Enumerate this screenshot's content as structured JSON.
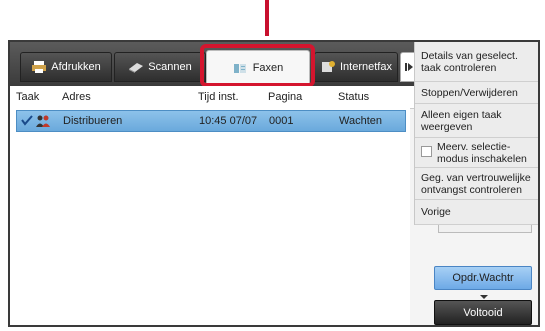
{
  "tabs": [
    {
      "label": "Afdrukken",
      "icon": "printer-icon"
    },
    {
      "label": "Scannen",
      "icon": "scanner-icon"
    },
    {
      "label": "Faxen",
      "icon": "fax-icon",
      "selected": true
    },
    {
      "label": "Internetfax",
      "icon": "internet-fax-icon"
    }
  ],
  "more_tabs_icon": "play-next-icon",
  "table": {
    "headers": [
      "Taak",
      "Adres",
      "Tijd inst.",
      "Pagina",
      "Status"
    ],
    "rows": [
      {
        "selected": true,
        "icons": [
          "checkmark-icon",
          "group-users-icon"
        ],
        "address": "Distribueren",
        "time": "10:45 07/07",
        "pages": "0001",
        "status": "Wachten"
      }
    ]
  },
  "menu": {
    "item1": "Details van geselect. taak controleren",
    "item2": "Stoppen/Verwijderen",
    "item3": "Alleen eigen taak weergeven",
    "item4": "Meerv. selectie-modus inschakelen",
    "item5": "Geg. van vertrouwelijke ontvangst controleren",
    "item6": "Vorige"
  },
  "buttons": {
    "print_queue": "Opdr.Wachtr",
    "done": "Voltooid"
  },
  "colors": {
    "highlight": "#d4152e",
    "selected_row": "#7ab4e3",
    "accent_button": "#8bbff0"
  }
}
